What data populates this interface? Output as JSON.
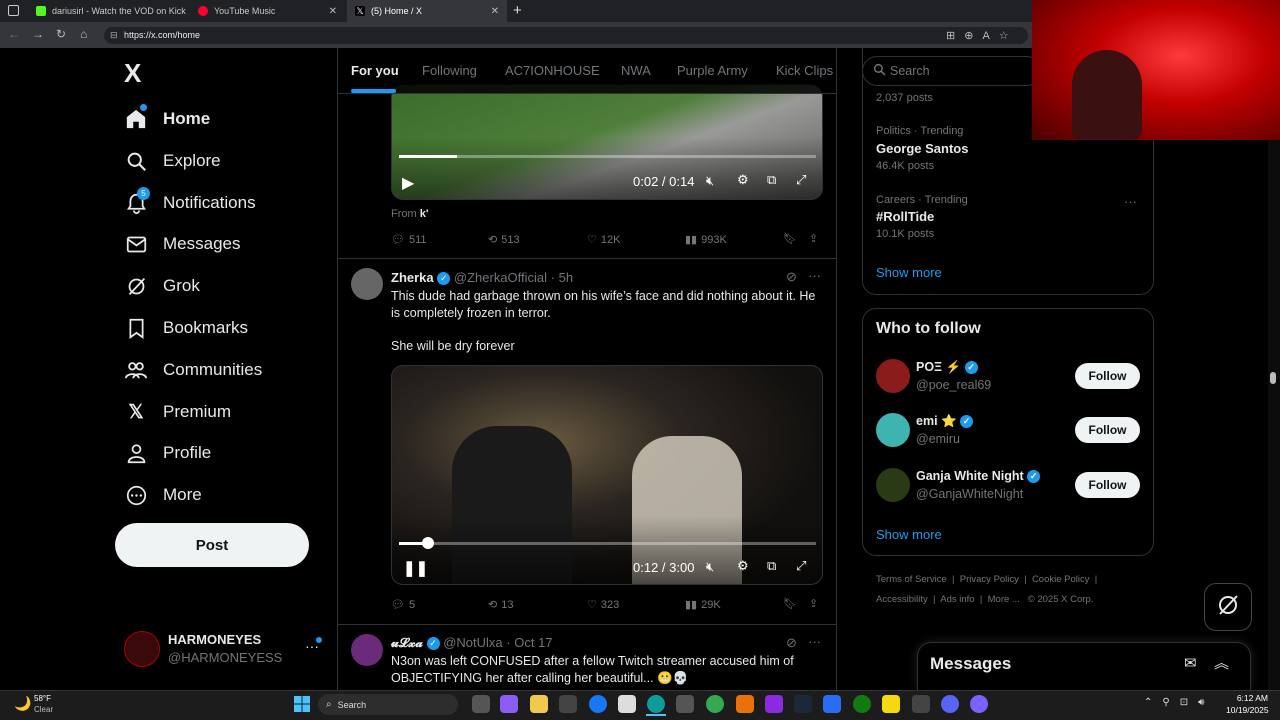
{
  "browser": {
    "tabs": [
      {
        "title": "dariusirl - Watch the VOD on Kick",
        "color": "#53fc18"
      },
      {
        "title": "YouTube Music",
        "color": "#ff0033"
      },
      {
        "title": "(5) Home / X",
        "color": "#ffffff"
      }
    ],
    "url": "https://x.com/home"
  },
  "sidebar": {
    "logo": "X",
    "items": [
      {
        "label": "Home",
        "icon": "home-icon"
      },
      {
        "label": "Explore",
        "icon": "search-icon"
      },
      {
        "label": "Notifications",
        "icon": "bell-icon",
        "badge": "5"
      },
      {
        "label": "Messages",
        "icon": "mail-icon"
      },
      {
        "label": "Grok",
        "icon": "grok-icon"
      },
      {
        "label": "Bookmarks",
        "icon": "bookmark-icon"
      },
      {
        "label": "Communities",
        "icon": "people-icon"
      },
      {
        "label": "Premium",
        "icon": "x-icon"
      },
      {
        "label": "Profile",
        "icon": "person-icon"
      },
      {
        "label": "More",
        "icon": "more-circle-icon"
      }
    ],
    "post_label": "Post",
    "account": {
      "name": "HARMONEYES",
      "handle": "@HARMONEYESS"
    }
  },
  "feed_tabs": [
    "For you",
    "Following",
    "AC7IONHOUSE",
    "NWA",
    "Purple Army",
    "Kick Clips"
  ],
  "tweets": [
    {
      "video_time": "0:02 / 0:14",
      "video_progress": 0.14,
      "from_label": "From",
      "from_source": "k'",
      "stats": {
        "replies": "511",
        "reposts": "513",
        "likes": "12K",
        "views": "993K"
      }
    },
    {
      "name": "Zherka",
      "handle": "@ZherkaOfficial",
      "time": "5h",
      "text1": "This dude had garbage thrown on his wife’s face and did nothing about it. He is completely frozen in terror.",
      "text2": "She will be dry forever",
      "video_time": "0:12 / 3:00",
      "video_progress": 0.07,
      "stats": {
        "replies": "5",
        "reposts": "13",
        "likes": "323",
        "views": "29K"
      }
    },
    {
      "name": "𝓾𝓛𝔁𝓪",
      "handle": "@NotUlxa",
      "time": "Oct 17",
      "text1": "N3on was left CONFUSED after a fellow Twitch streamer accused him of OBJECTIFYING her after calling her beautiful... 😬💀"
    }
  ],
  "right": {
    "search_placeholder": "Search",
    "trends": [
      {
        "meta": "",
        "name": "",
        "posts": "2,037 posts"
      },
      {
        "meta": "Politics · Trending",
        "name": "George Santos",
        "posts": "46.4K posts"
      },
      {
        "meta": "Careers · Trending",
        "name": "#RollTide",
        "posts": "10.1K posts"
      }
    ],
    "trends_show_more": "Show more",
    "who_to_follow_title": "Who to follow",
    "follow_suggestions": [
      {
        "name": "POΞ ⚡",
        "handle": "@poe_real69",
        "follow": "Follow"
      },
      {
        "name": "emi ⭐",
        "handle": "@emiru",
        "follow": "Follow"
      },
      {
        "name": "Ganja White Night",
        "handle": "@GanjaWhiteNight",
        "follow": "Follow"
      }
    ],
    "wtf_show_more": "Show more",
    "footer": [
      "Terms of Service",
      "Privacy Policy",
      "Cookie Policy",
      "Accessibility",
      "Ads info",
      "More ...",
      "© 2025 X Corp."
    ],
    "messages_title": "Messages"
  },
  "taskbar": {
    "weather_temp": "58°F",
    "weather_cond": "Clear",
    "search": "Search",
    "time": "6:12 AM",
    "date": "10/19/2025"
  }
}
